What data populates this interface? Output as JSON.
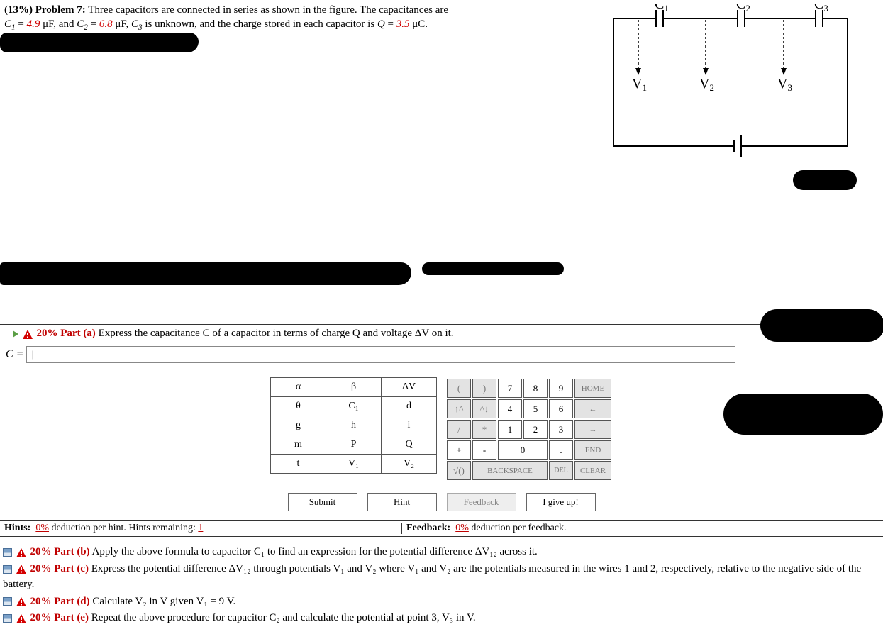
{
  "problem": {
    "percent_label": "(13%)",
    "title": "Problem 7:",
    "text_1": "Three capacitors are connected in series as shown in the figure. The capacitances are",
    "c1_lhs": "C",
    "c1_sub": "1",
    "eq": " = ",
    "c1_val": "4.9",
    "uf": " μF, and ",
    "c2_lhs": "C",
    "c2_sub": "2",
    "c2_val": "6.8",
    "uf2": " μF, ",
    "c3_lhs": "C",
    "c3_sub": "3",
    "text_2": " is unknown, and the charge stored in each capacitor is ",
    "q_lhs": "Q",
    "q_val": "3.5",
    "uc": " μC."
  },
  "circuit": {
    "c1": "C",
    "c1s": "1",
    "c2": "C",
    "c2s": "2",
    "c3": "C",
    "c3s": "3",
    "v1": "V",
    "v1s": "1",
    "v2": "V",
    "v2s": "2",
    "v3": "V",
    "v3s": "3"
  },
  "part_a": {
    "pct": "20% ",
    "label": "Part (a)",
    "text": "  Express the capacitance C of a capacitor in terms of charge Q and voltage ΔV on it.",
    "lhs": "C = ",
    "value": "|"
  },
  "keypad_left": {
    "r1": [
      "α",
      "β",
      "ΔV"
    ],
    "r2": [
      "θ",
      "C₁",
      "d"
    ],
    "r3": [
      "g",
      "h",
      "i"
    ],
    "r4": [
      "m",
      "P",
      "Q"
    ],
    "r5": [
      "t",
      "V₁",
      "V₂"
    ]
  },
  "keypad_right": {
    "r1": [
      "(",
      ")",
      "7",
      "8",
      "9",
      "HOME"
    ],
    "r2": [
      "↑^",
      "^↓",
      "4",
      "5",
      "6",
      "←"
    ],
    "r3": [
      "/",
      "*",
      "1",
      "2",
      "3",
      "→"
    ],
    "r4": [
      "+",
      "-",
      "0",
      ".",
      "END"
    ],
    "r5": [
      "√()",
      "BACKSPACE",
      "DEL",
      "CLEAR"
    ]
  },
  "actions": {
    "submit": "Submit",
    "hint": "Hint",
    "feedback": "Feedback",
    "giveup": "I give up!"
  },
  "hints_bar": {
    "hints_label": "Hints:",
    "hints_pct": "0%",
    "hints_rest": " deduction per hint. Hints remaining: ",
    "hints_remain": "1",
    "feedback_label": "Feedback:",
    "feedback_pct": "0%",
    "feedback_rest": " deduction per feedback."
  },
  "parts": {
    "b": {
      "pct": "20% ",
      "label": "Part (b)",
      "text": "  Apply the above formula to capacitor C₁ to find an expression for the potential difference ΔV₁₂ across it."
    },
    "c": {
      "pct": "20% ",
      "label": "Part (c)",
      "text": "  Express the potential difference ΔV₁₂ through potentials V₁ and V₂ where V₁ and V₂ are the potentials measured in the wires 1 and 2, respectively, relative to the negative side of the battery."
    },
    "d": {
      "pct": "20% ",
      "label": "Part (d)",
      "text": "  Calculate V₂ in V given V₁ = 9 V."
    },
    "e": {
      "pct": "20% ",
      "label": "Part (e)",
      "text": "  Repeat the above procedure for capacitor C₂ and calculate the potential at point 3, V₃ in V."
    }
  }
}
